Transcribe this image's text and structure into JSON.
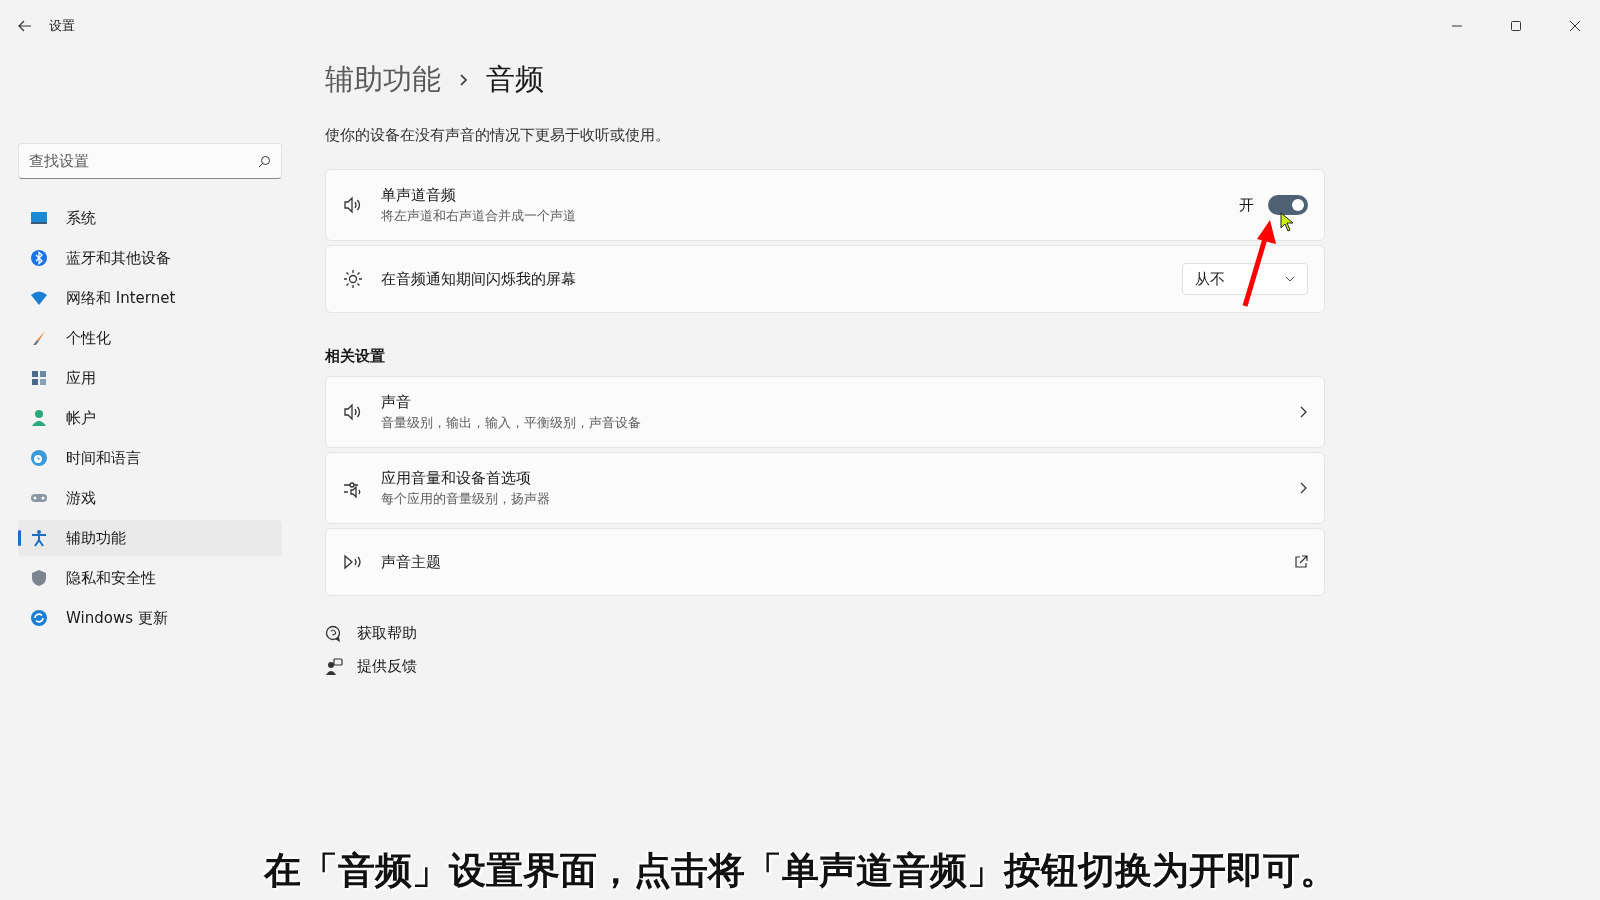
{
  "window": {
    "title": "设置"
  },
  "search": {
    "placeholder": "查找设置"
  },
  "sidebar": {
    "items": [
      {
        "kind": "system",
        "label": "系统",
        "selected": false
      },
      {
        "kind": "bluetooth",
        "label": "蓝牙和其他设备",
        "selected": false
      },
      {
        "kind": "network",
        "label": "网络和 Internet",
        "selected": false
      },
      {
        "kind": "personalize",
        "label": "个性化",
        "selected": false
      },
      {
        "kind": "apps",
        "label": "应用",
        "selected": false
      },
      {
        "kind": "account",
        "label": "帐户",
        "selected": false
      },
      {
        "kind": "time",
        "label": "时间和语言",
        "selected": false
      },
      {
        "kind": "gaming",
        "label": "游戏",
        "selected": false
      },
      {
        "kind": "accessibility",
        "label": "辅助功能",
        "selected": true
      },
      {
        "kind": "privacy",
        "label": "隐私和安全性",
        "selected": false
      },
      {
        "kind": "update",
        "label": "Windows 更新",
        "selected": false
      }
    ]
  },
  "breadcrumb": {
    "parent": "辅助功能",
    "current": "音频"
  },
  "description": "使你的设备在没有声音的情况下更易于收听或使用。",
  "cards": [
    {
      "kind": "toggle",
      "title": "单声道音频",
      "subtitle": "将左声道和右声道合并成一个声道",
      "state_label": "开",
      "on": true
    },
    {
      "kind": "dropdown",
      "title": "在音频通知期间闪烁我的屏幕",
      "value": "从不"
    }
  ],
  "related": {
    "heading": "相关设置",
    "items": [
      {
        "kind": "link",
        "title": "声音",
        "subtitle": "音量级别，输出，输入，平衡级别，声音设备"
      },
      {
        "kind": "link",
        "title": "应用音量和设备首选项",
        "subtitle": "每个应用的音量级别，扬声器"
      },
      {
        "kind": "external",
        "title": "声音主题"
      }
    ]
  },
  "help_links": [
    {
      "label": "获取帮助"
    },
    {
      "label": "提供反馈"
    }
  ],
  "caption": "在「音频」设置界面，点击将「单声道音频」按钮切换为开即可。"
}
